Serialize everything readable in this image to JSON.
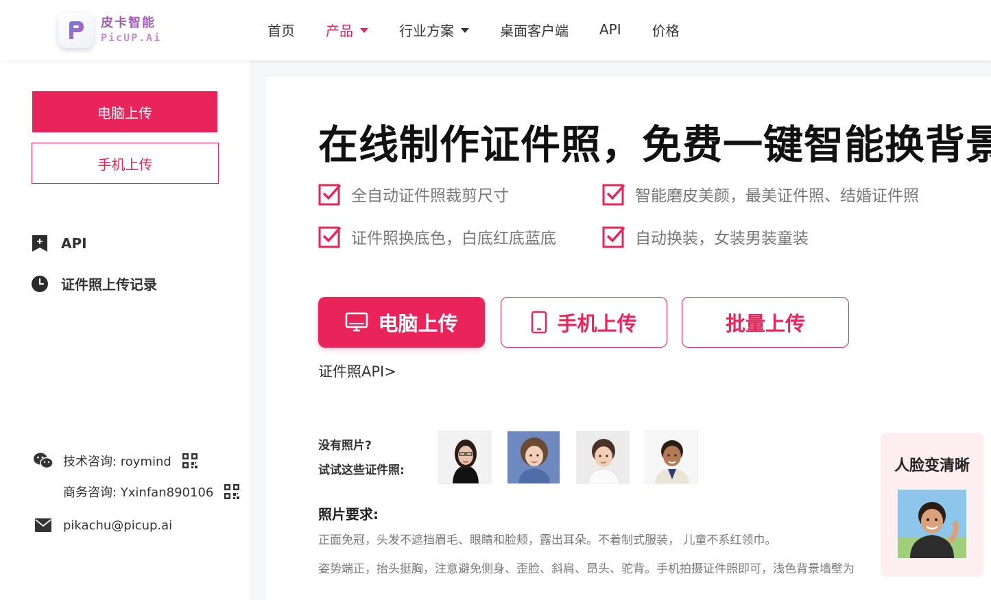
{
  "brand": {
    "name_cn": "皮卡智能",
    "name_en": "PicUP.Ai",
    "accent": "#e8245a",
    "logo_color": "#a35bb8"
  },
  "nav": [
    {
      "label": "首页",
      "active": false,
      "dropdown": false
    },
    {
      "label": "产品",
      "active": true,
      "dropdown": true
    },
    {
      "label": "行业方案",
      "active": false,
      "dropdown": true
    },
    {
      "label": "桌面客户端",
      "active": false,
      "dropdown": false
    },
    {
      "label": "API",
      "active": false,
      "dropdown": false
    },
    {
      "label": "价格",
      "active": false,
      "dropdown": false
    }
  ],
  "sidebar": {
    "pc_upload": "电脑上传",
    "mobile_upload": "手机上传",
    "api_label": "API",
    "records_label": "证件照上传记录",
    "contact": {
      "tech": "技术咨询: roymind",
      "business": "商务咨询: Yxinfan890106",
      "email": "pikachu@picup.ai"
    }
  },
  "main": {
    "headline": "在线制作证件照，免费一键智能换背景",
    "features": [
      "全自动证件照裁剪尺寸",
      "智能磨皮美颜，最美证件照、结婚证件照",
      "证件照换底色，白底红底蓝底",
      "自动换装，女装男装童装"
    ],
    "buttons": {
      "pc": "电脑上传",
      "mobile": "手机上传",
      "batch": "批量上传"
    },
    "api_link": "证件照API>",
    "samples": {
      "line1": "没有照片?",
      "line2": "试试这些证件照:"
    },
    "requirements": {
      "title": "照片要求:",
      "line1": "正面免冠，头发不遮挡眉毛、眼睛和脸颊，露出耳朵。不着制式服装， 儿童不系红领巾。",
      "line2": "姿势端正，抬头挺胸，注意避免侧身、歪脸、斜肩、昂头、驼背。手机拍摄证件照即可，浅色背景墙壁为"
    }
  },
  "promo": {
    "title": "人脸变清晰"
  }
}
